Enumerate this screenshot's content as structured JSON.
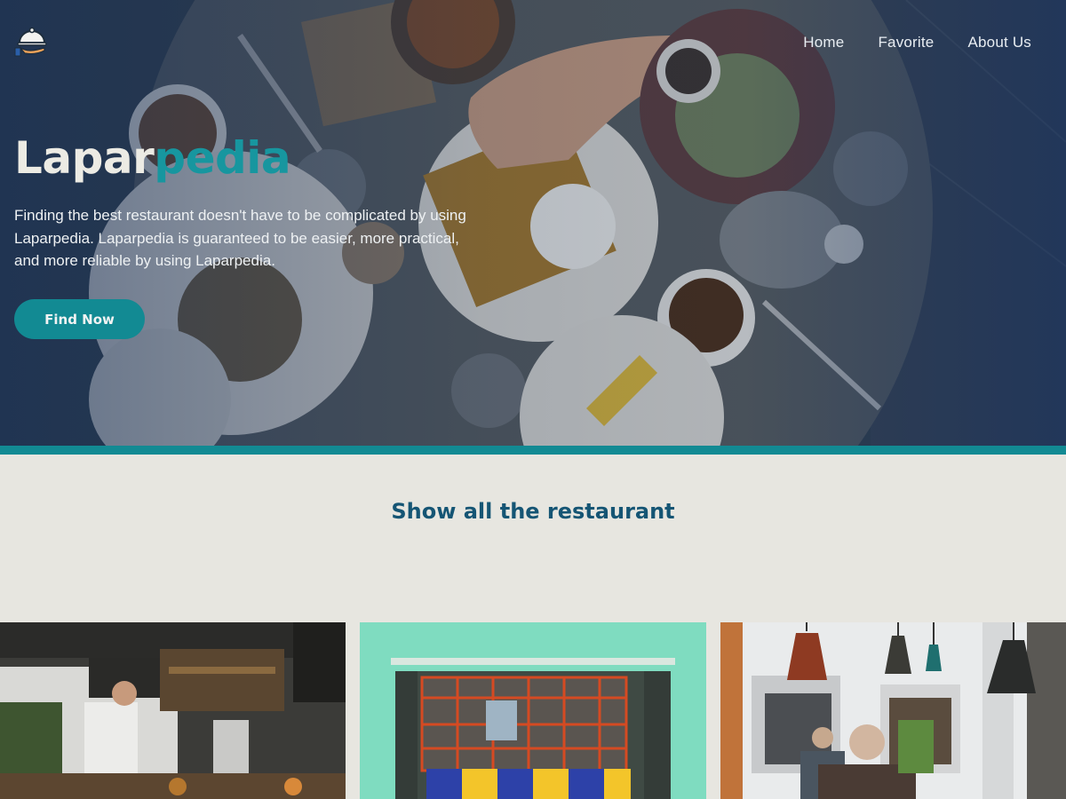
{
  "header": {
    "logo_icon": "food-cloche-hand-icon",
    "nav": [
      {
        "label": "Home"
      },
      {
        "label": "Favorite"
      },
      {
        "label": "About Us"
      }
    ]
  },
  "hero": {
    "brand_part1": "Lapar",
    "brand_part2": "pedia",
    "tagline": "Finding the best restaurant doesn't have to be complicated by using Laparpedia. Laparpedia is guaranteed to be easier, more practical, and more reliable by using Laparpedia.",
    "cta_label": "Find Now"
  },
  "restaurants": {
    "title": "Show all the restaurant"
  },
  "colors": {
    "accent": "#128a93",
    "brand_highlight": "#17969f",
    "section_title": "#155574",
    "page_background": "#e7e6e0",
    "hero_overlay": "#1a3a6a"
  }
}
